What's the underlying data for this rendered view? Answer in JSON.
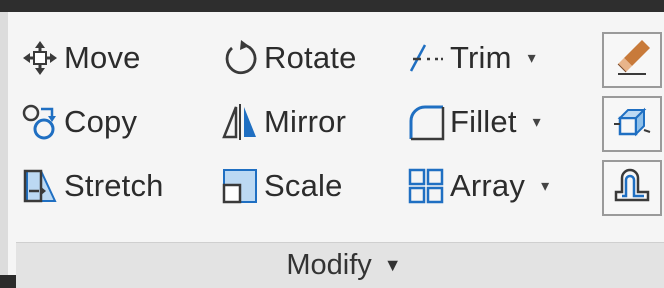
{
  "panel": {
    "title": "Modify",
    "title_caret": "▼",
    "colors": {
      "accent_blue": "#1f6fc2",
      "icon_dark": "#3a3a3a",
      "panel_bg": "#f5f5f5",
      "footer_bg": "#e3e3e3"
    }
  },
  "tools": {
    "move": {
      "label": "Move",
      "icon": "move-icon"
    },
    "copy": {
      "label": "Copy",
      "icon": "copy-icon"
    },
    "stretch": {
      "label": "Stretch",
      "icon": "stretch-icon"
    },
    "rotate": {
      "label": "Rotate",
      "icon": "rotate-icon"
    },
    "mirror": {
      "label": "Mirror",
      "icon": "mirror-icon"
    },
    "scale": {
      "label": "Scale",
      "icon": "scale-icon"
    },
    "trim": {
      "label": "Trim",
      "icon": "trim-icon",
      "dropdown": "▾"
    },
    "fillet": {
      "label": "Fillet",
      "icon": "fillet-icon",
      "dropdown": "▾"
    },
    "array": {
      "label": "Array",
      "icon": "array-icon",
      "dropdown": "▾"
    }
  },
  "side_buttons": [
    "erase-icon",
    "explode-icon",
    "offset-icon"
  ]
}
